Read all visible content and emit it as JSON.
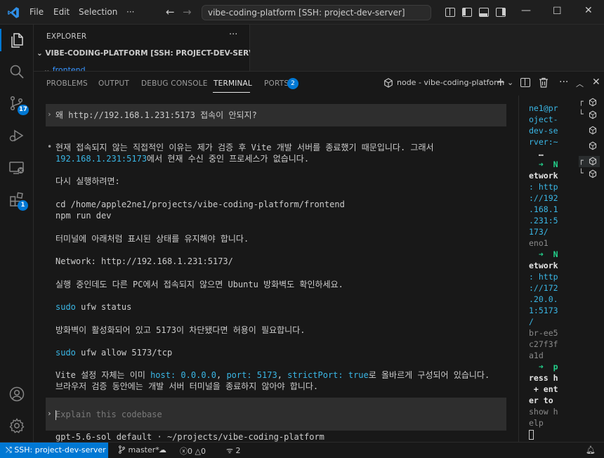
{
  "menu": [
    "File",
    "Edit",
    "Selection",
    "···"
  ],
  "command_center": "vibe-coding-platform [SSH: project-dev-server]",
  "explorer": {
    "title": "EXPLORER",
    "more": "···",
    "root": "VIBE-CODING-PLATFORM [SSH: PROJECT-DEV-SERVER]",
    "folder": "frontend"
  },
  "activity_badges": {
    "source_control": "17",
    "extensions": "1"
  },
  "panel_tabs": [
    "PROBLEMS",
    "OUTPUT",
    "DEBUG CONSOLE",
    "TERMINAL",
    "PORTS"
  ],
  "ports_count": "2",
  "terminal_name": "node - vibe-coding-platform",
  "terminal": {
    "user_prompt": "왜 http://192.168.1.231:5173 접속이 안되지?",
    "answer_line1": "현재 접속되지 않는 직접적인 이유는 제가 검증 후 Vite 개발 서버를 종료했기 때문입니다. 그래서",
    "answer_ip": "192.168.1.231:5173",
    "answer_line2_rest": "에서 현재 수신 중인 프로세스가 없습니다.",
    "rerun": "다시 실행하려면:",
    "cmd_cd": "cd /home/apple2ne1/projects/vibe-coding-platform/frontend",
    "cmd_npm": "npm run dev",
    "keep_state": "터미널에 아래처럼 표시된 상태를 유지해야 합니다.",
    "network_line": "Network: http://192.168.1.231:5173/",
    "firewall_check": "실행 중인데도 다른 PC에서 접속되지 않으면 Ubuntu 방화벽도 확인하세요.",
    "cmd_ufw_status_sudo": "sudo",
    "cmd_ufw_status_rest": " ufw status",
    "allow_note": "방화벽이 활성화되어 있고 5173이 차단됐다면 허용이 필요합니다.",
    "cmd_ufw_allow_sudo": "sudo",
    "cmd_ufw_allow_rest": " ufw allow 5173/tcp",
    "vite_pre": "Vite 설정 자체는 이미 ",
    "vite_host": "host: 0.0.0.0",
    "vite_comma1": ", ",
    "vite_port": "port: 5173",
    "vite_comma2": ", ",
    "vite_strict": "strictPort: true",
    "vite_post": "로 올바르게 구성되어 있습니다.",
    "vite_line2": "브라우저 검증 동안에는 개발 서버 터미널을 종료하지 않아야 합니다.",
    "input_placeholder": "Explain this codebase",
    "footer": "gpt-5.6-sol default · ~/projects/vibe-coding-platform"
  },
  "side_terminal": [
    {
      "t": "ne1@pr",
      "c": "cyan"
    },
    {
      "t": "oject-",
      "c": "cyan"
    },
    {
      "t": "dev-se",
      "c": "cyan"
    },
    {
      "t": "rver:~",
      "c": "cyan"
    },
    {
      "t": "  …",
      "c": "white"
    },
    {
      "t": "  ➜  N",
      "c": "green-white"
    },
    {
      "t": "etwork",
      "c": "white"
    },
    {
      "t": ": http",
      "c": "cyan"
    },
    {
      "t": "://192",
      "c": "cyan"
    },
    {
      "t": ".168.1",
      "c": "cyan"
    },
    {
      "t": ".231:5",
      "c": "cyan"
    },
    {
      "t": "173/",
      "c": "cyan"
    },
    {
      "t": "eno1",
      "c": "grey"
    },
    {
      "t": "  ➜  N",
      "c": "green-white"
    },
    {
      "t": "etwork",
      "c": "white"
    },
    {
      "t": ": http",
      "c": "cyan"
    },
    {
      "t": "://172",
      "c": "cyan"
    },
    {
      "t": ".20.0.",
      "c": "cyan"
    },
    {
      "t": "1:5173",
      "c": "cyan"
    },
    {
      "t": "/",
      "c": "cyan"
    },
    {
      "t": "br-ee5",
      "c": "grey"
    },
    {
      "t": "c27f3f",
      "c": "grey"
    },
    {
      "t": "a1d",
      "c": "grey"
    },
    {
      "t": "  ➜  p",
      "c": "green-grey"
    },
    {
      "t": "ress h",
      "c": "grey-white"
    },
    {
      "t": " + ent",
      "c": "white"
    },
    {
      "t": "er to",
      "c": "grey-white2"
    },
    {
      "t": "show h",
      "c": "grey"
    },
    {
      "t": "elp",
      "c": "grey"
    }
  ],
  "status": {
    "remote": "SSH: project-dev-server",
    "branch": "master*",
    "errors": "0",
    "warnings": "0",
    "ports": "2"
  }
}
